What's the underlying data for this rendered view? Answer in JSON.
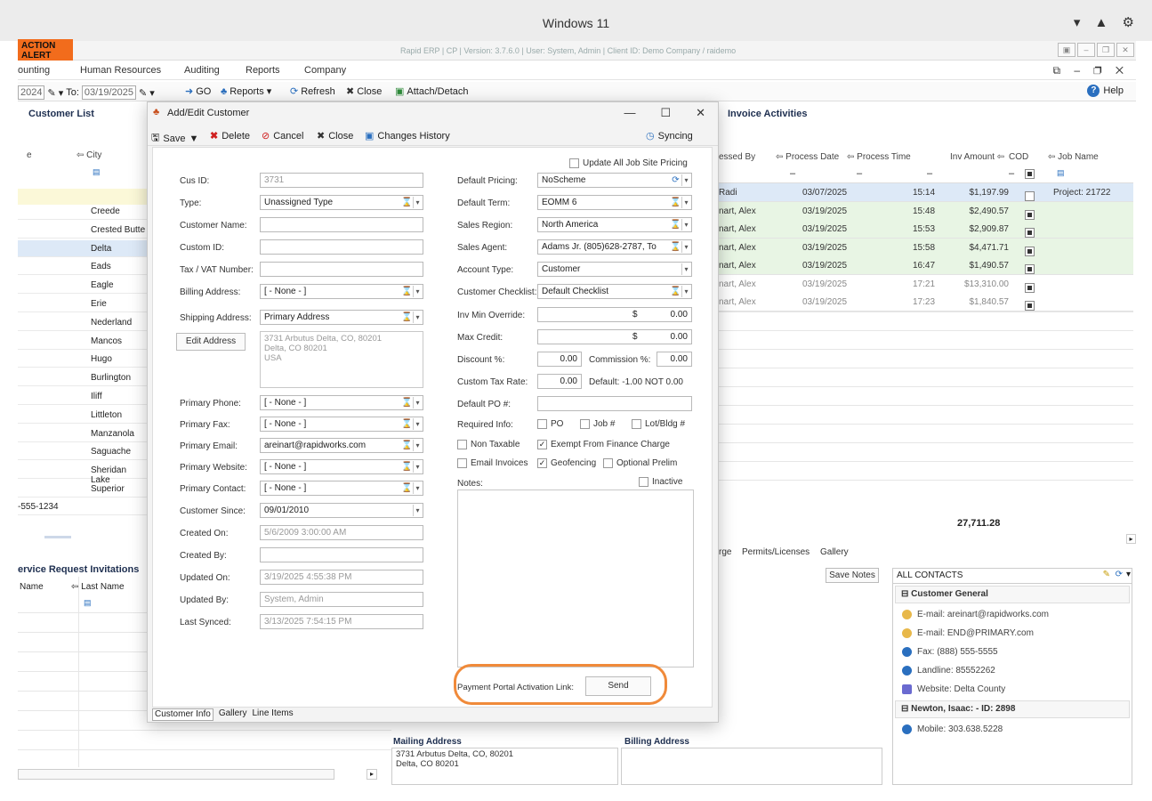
{
  "os_title": "Windows 11",
  "appbar": {
    "alert_label": "ACTION ALERT",
    "version_text": "Rapid ERP | CP | Version: 3.7.6.0 | User: System, Admin | Client ID: Demo Company / raidemo"
  },
  "menu": [
    "ounting",
    "Human Resources",
    "Auditing",
    "Reports",
    "Company"
  ],
  "toolbar": {
    "from_date": "2024",
    "to_label": "To:",
    "to_date": "03/19/2025",
    "go": "GO",
    "reports": "Reports",
    "refresh": "Refresh",
    "close": "Close",
    "attach": "Attach/Detach",
    "help": "Help"
  },
  "customer_list": {
    "title": "Customer List",
    "col_e": "e",
    "col_city": "City",
    "cities": [
      "Creede",
      "Crested Butte",
      "Delta",
      "Eads",
      "Eagle",
      "Erie",
      "Nederland",
      "Mancos",
      "Hugo",
      "Burlington",
      "Iliff",
      "Littleton",
      "Manzanola",
      "Saguache",
      "Sheridan Lake",
      "Superior"
    ],
    "phone": "-555-1234"
  },
  "service_requests": {
    "title": "ervice Request Invitations",
    "col_name": "Name",
    "col_last": "Last Name"
  },
  "invoice_activities": {
    "title": "Invoice Activities",
    "headers": [
      "essed By",
      "Process Date",
      "Process Time",
      "Inv Amount",
      "COD",
      "Job Name"
    ],
    "rows": [
      {
        "by": "Radi",
        "date": "03/07/2025",
        "time": "15:14",
        "amount": "$1,197.99",
        "job": "Project: 21722"
      },
      {
        "by": "nart, Alex",
        "date": "03/19/2025",
        "time": "15:48",
        "amount": "$2,490.57",
        "job": ""
      },
      {
        "by": "nart, Alex",
        "date": "03/19/2025",
        "time": "15:53",
        "amount": "$2,909.87",
        "job": ""
      },
      {
        "by": "nart, Alex",
        "date": "03/19/2025",
        "time": "15:58",
        "amount": "$4,471.71",
        "job": ""
      },
      {
        "by": "nart, Alex",
        "date": "03/19/2025",
        "time": "16:47",
        "amount": "$1,490.57",
        "job": ""
      },
      {
        "by": "nart, Alex",
        "date": "03/19/2025",
        "time": "17:21",
        "amount": "$13,310.00",
        "job": ""
      },
      {
        "by": "nart, Alex",
        "date": "03/19/2025",
        "time": "17:23",
        "amount": "$1,840.57",
        "job": ""
      }
    ],
    "total": "27,711.28"
  },
  "bottom_tabs": {
    "t1": "rge",
    "t2": "Permits/Licenses",
    "t3": "Gallery",
    "save_notes": "Save Notes"
  },
  "contacts": {
    "title": "ALL CONTACTS",
    "group1": "Customer General",
    "lines1": [
      "E-mail: areinart@rapidworks.com",
      "E-mail: END@PRIMARY.com",
      "Fax: (888) 555-5555",
      "Landline: 85552262",
      "Website: Delta County"
    ],
    "group2": "Newton, Isaac:  - ID: 2898",
    "lines2": [
      "Mobile: 303.638.5228"
    ]
  },
  "addresses": {
    "mailing_title": "Mailing Address",
    "mailing_line1": "3731 Arbutus Delta, CO, 80201",
    "mailing_line2": "Delta, CO 80201",
    "billing_title": "Billing Address"
  },
  "dialog": {
    "title": "Add/Edit Customer",
    "tools": {
      "save": "Save",
      "delete": "Delete",
      "cancel": "Cancel",
      "close": "Close",
      "history": "Changes History",
      "syncing": "Syncing"
    },
    "left": {
      "cus_id_label": "Cus ID:",
      "cus_id": "3731",
      "type_label": "Type:",
      "type": "Unassigned Type",
      "customer_name_label": "Customer Name:",
      "custom_id_label": "Custom ID:",
      "tax_label": "Tax / VAT Number:",
      "billing_label": "Billing Address:",
      "billing": "[ - None - ]",
      "shipping_label": "Shipping Address:",
      "shipping": "Primary Address",
      "edit_address": "Edit Address",
      "addr1": "3731 Arbutus Delta, CO, 80201",
      "addr2": "Delta, CO 80201",
      "addr3": "USA",
      "phone_label": "Primary Phone:",
      "phone": "[ - None - ]",
      "fax_label": "Primary Fax:",
      "fax": "[ - None - ]",
      "email_label": "Primary Email:",
      "email": "areinart@rapidworks.com",
      "website_label": "Primary Website:",
      "website": "[ - None - ]",
      "contact_label": "Primary Contact:",
      "contact": "[ - None - ]",
      "since_label": "Customer Since:",
      "since": "09/01/2010",
      "created_on_label": "Created On:",
      "created_on": "5/6/2009 3:00:00 AM",
      "created_by_label": "Created By:",
      "updated_on_label": "Updated On:",
      "updated_on": "3/19/2025 4:55:38 PM",
      "updated_by_label": "Updated By:",
      "updated_by": "System, Admin",
      "last_synced_label": "Last Synced:",
      "last_synced": "3/13/2025 7:54:15 PM"
    },
    "right": {
      "update_all": "Update All Job Site Pricing",
      "pricing_label": "Default Pricing:",
      "pricing": "NoScheme",
      "term_label": "Default Term:",
      "term": "EOMM 6",
      "region_label": "Sales Region:",
      "region": "North America",
      "agent_label": "Sales Agent:",
      "agent": "Adams Jr. (805)628-2787, To",
      "acct_label": "Account Type:",
      "acct": "Customer",
      "checklist_label": "Customer Checklist:",
      "checklist": "Default Checklist",
      "invmin_label": "Inv Min Override:",
      "invmin": "0.00",
      "maxcredit_label": "Max Credit:",
      "maxcredit": "0.00",
      "currency": "$",
      "discount_label": "Discount %:",
      "discount": "0.00",
      "commission_label": "Commission %:",
      "commission": "0.00",
      "taxrate_label": "Custom Tax Rate:",
      "taxrate": "0.00",
      "taxrate_default": "Default: -1.00 NOT 0.00",
      "po_label": "Default PO #:",
      "required_label": "Required Info:",
      "req_po": "PO",
      "req_job": "Job #",
      "req_lot": "Lot/Bldg #",
      "non_taxable": "Non Taxable",
      "exempt": "Exempt From Finance Charge",
      "email_invoices": "Email Invoices",
      "geofencing": "Geofencing",
      "optional_prelim": "Optional Prelim",
      "notes_label": "Notes:",
      "inactive": "Inactive",
      "portal_label": "Payment Portal Activation Link:",
      "send": "Send"
    },
    "tabs": [
      "Customer Info",
      "Gallery",
      "Line Items"
    ]
  }
}
